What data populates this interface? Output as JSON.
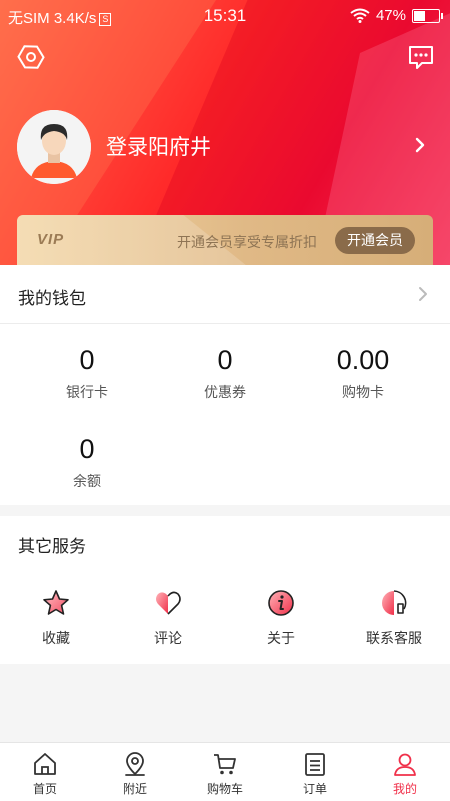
{
  "status_bar": {
    "carrier": "无SIM",
    "speed": "3.4K/s",
    "speed_box": "S",
    "time": "15:31",
    "battery": "47%"
  },
  "colors": {
    "accent": "#f0304a",
    "header_red": "#ff2a2a",
    "vip_gold": "#e0b986",
    "vip_button": "#8a6b4a"
  },
  "header": {
    "settings_icon": "hexagon-settings-icon",
    "message_icon": "chat-bubble-icon",
    "login_text": "登录阳府井"
  },
  "vip": {
    "label": "VIP",
    "description": "开通会员享受专属折扣",
    "button": "开通会员"
  },
  "wallet": {
    "title": "我的钱包",
    "items": [
      {
        "value": "0",
        "label": "银行卡"
      },
      {
        "value": "0",
        "label": "优惠券"
      },
      {
        "value": "0.00",
        "label": "购物卡"
      },
      {
        "value": "0",
        "label": "余额"
      }
    ]
  },
  "services": {
    "title": "其它服务",
    "items": [
      {
        "label": "收藏",
        "icon": "star-icon"
      },
      {
        "label": "评论",
        "icon": "heart-icon"
      },
      {
        "label": "关于",
        "icon": "info-icon"
      },
      {
        "label": "联系客服",
        "icon": "headset-icon"
      }
    ]
  },
  "tabbar": {
    "active": 4,
    "items": [
      {
        "label": "首页",
        "icon": "home-icon"
      },
      {
        "label": "附近",
        "icon": "location-pin-icon"
      },
      {
        "label": "购物车",
        "icon": "cart-icon"
      },
      {
        "label": "订单",
        "icon": "order-list-icon"
      },
      {
        "label": "我的",
        "icon": "user-icon"
      }
    ]
  }
}
